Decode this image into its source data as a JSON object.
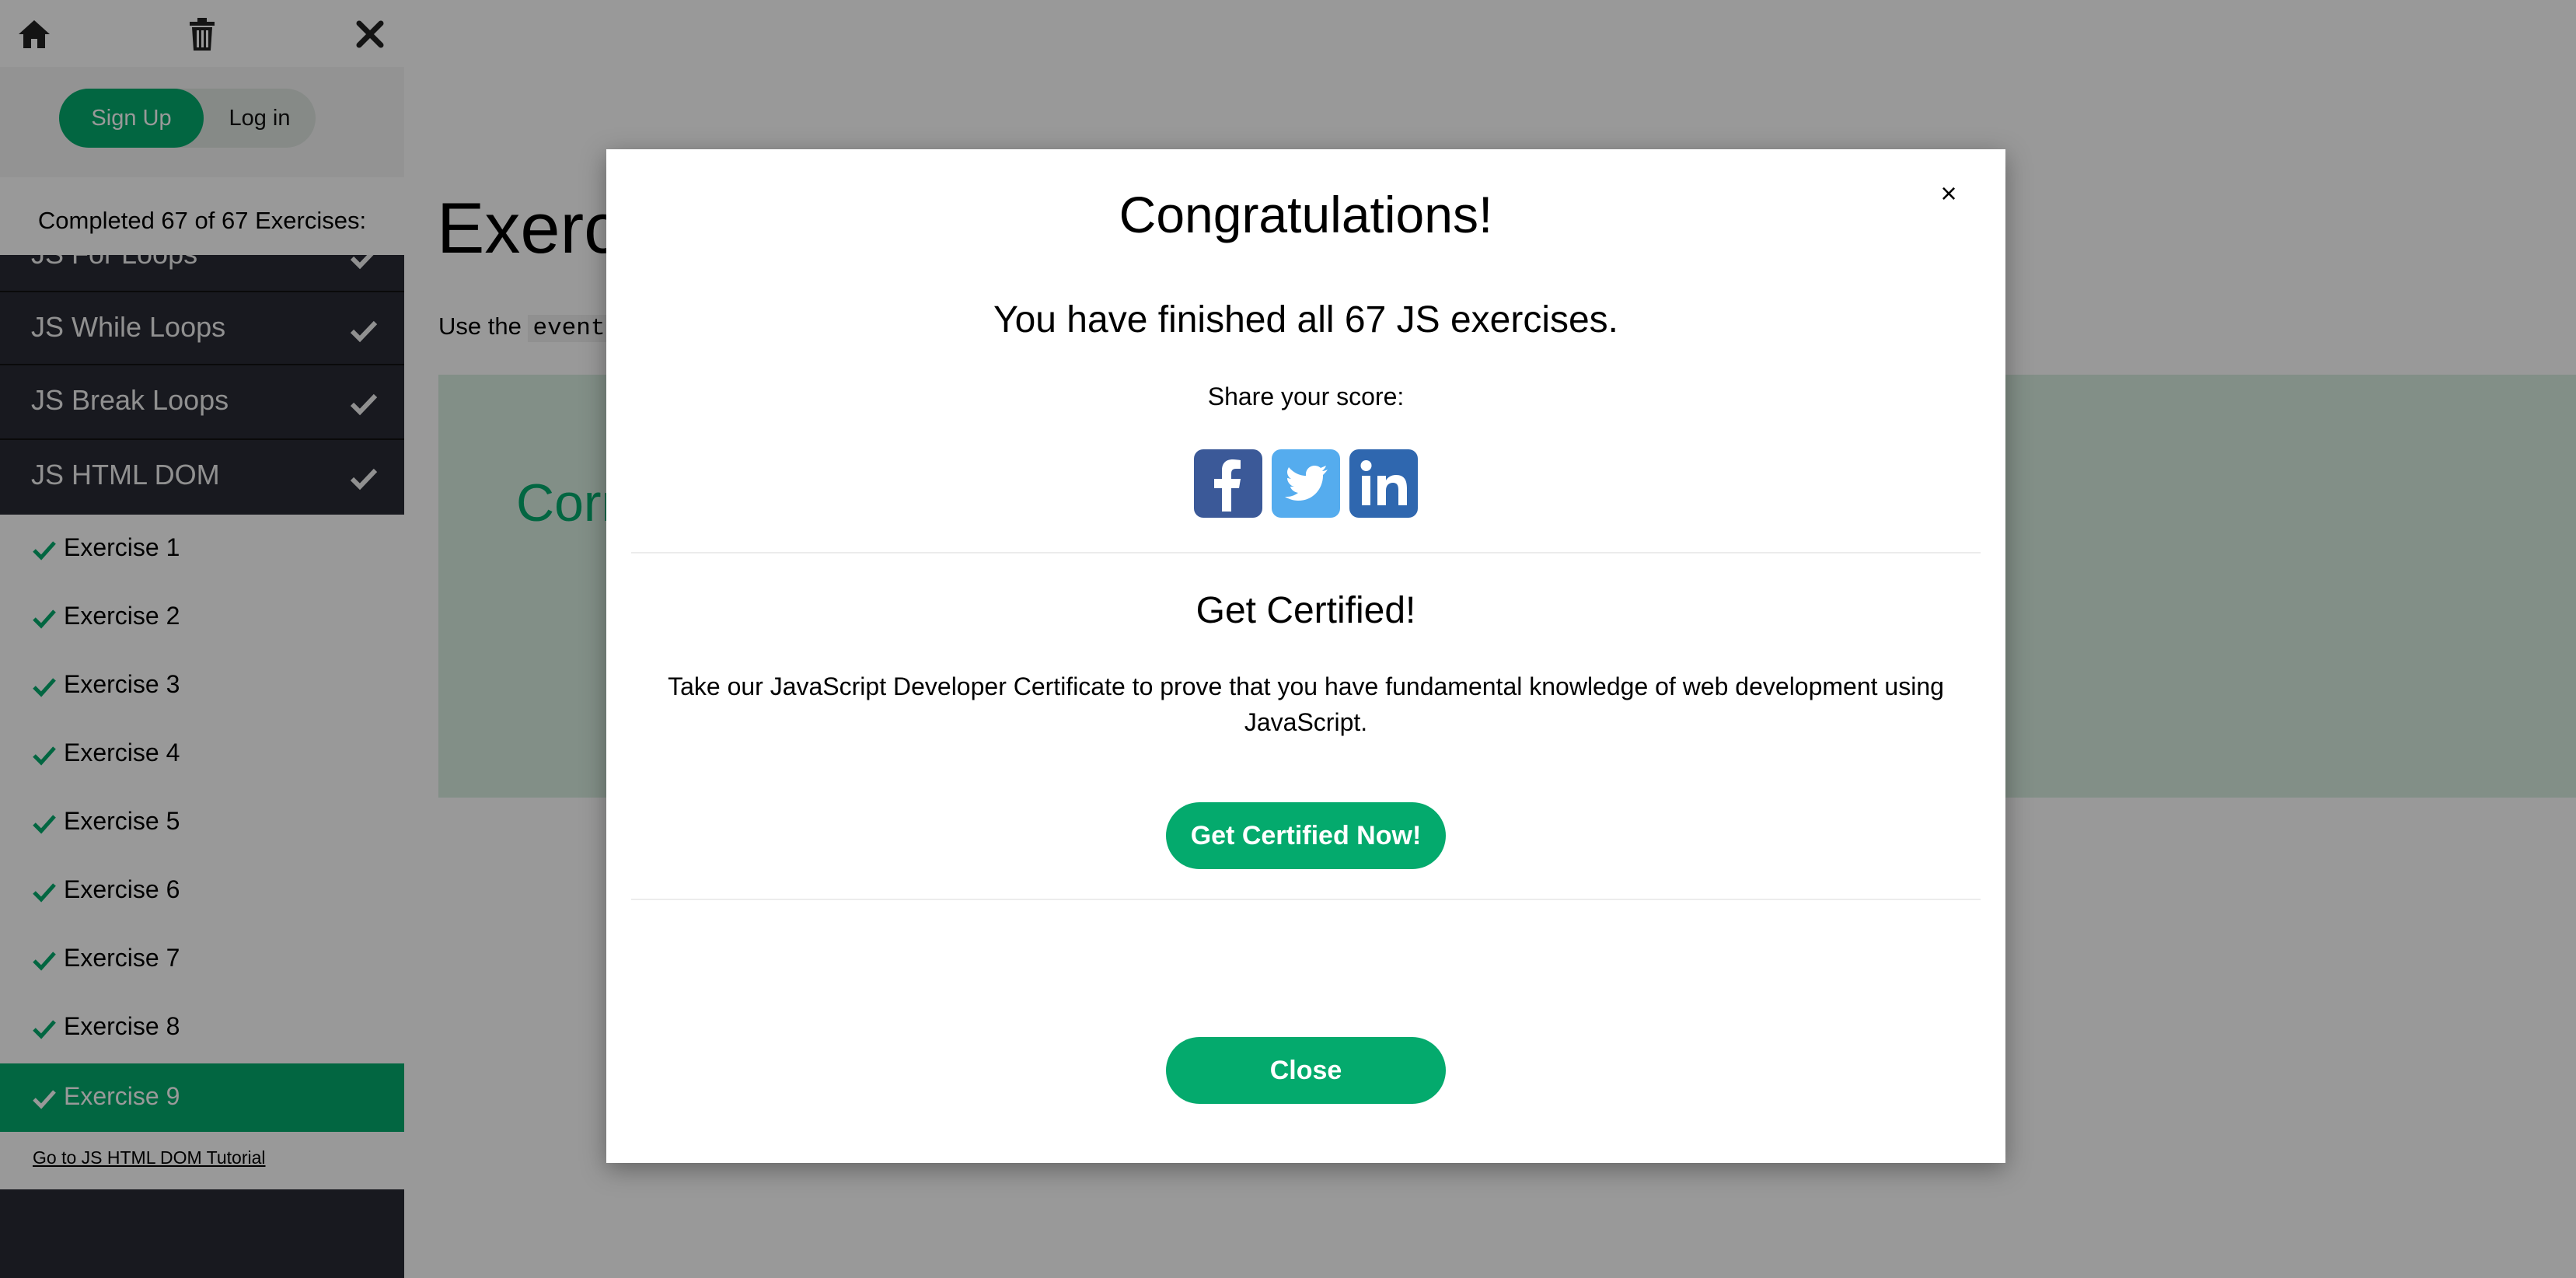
{
  "sidebar": {
    "top_icons": [
      "home-icon",
      "trash-icon",
      "close-icon"
    ],
    "signup_label": "Sign Up",
    "login_label": "Log in",
    "progress_text": "Completed 67 of 67 Exercises:",
    "sections": [
      {
        "label": "JS For Loops",
        "completed": true
      },
      {
        "label": "JS While Loops",
        "completed": true
      },
      {
        "label": "JS Break Loops",
        "completed": true
      },
      {
        "label": "JS HTML DOM",
        "completed": true
      }
    ],
    "exercises": [
      {
        "label": "Exercise 1",
        "completed": true
      },
      {
        "label": "Exercise 2",
        "completed": true
      },
      {
        "label": "Exercise 3",
        "completed": true
      },
      {
        "label": "Exercise 4",
        "completed": true
      },
      {
        "label": "Exercise 5",
        "completed": true
      },
      {
        "label": "Exercise 6",
        "completed": true
      },
      {
        "label": "Exercise 7",
        "completed": true
      },
      {
        "label": "Exercise 8",
        "completed": true
      },
      {
        "label": "Exercise 9",
        "completed": true,
        "active": true
      }
    ],
    "tutorial_link": "Go to JS HTML DOM Tutorial"
  },
  "main": {
    "title_partial": "Exerc",
    "instruction_prefix": "Use the",
    "instruction_code": "event",
    "result_partial": "Corr"
  },
  "modal": {
    "title": "Congratulations!",
    "finished_text": "You have finished all 67 JS exercises.",
    "share_label": "Share your score:",
    "social_icons": [
      "facebook-icon",
      "twitter-icon",
      "linkedin-icon"
    ],
    "cert_title": "Get Certified!",
    "cert_desc": "Take our JavaScript Developer Certificate to prove that you have fundamental knowledge of web development using JavaScript.",
    "cert_button": "Get Certified Now!",
    "close_button": "Close",
    "close_x": "×"
  },
  "colors": {
    "accent": "#04AA6D",
    "sidebar_dark": "#282A35",
    "facebook": "#3B5998",
    "twitter": "#55ACEE",
    "linkedin": "#2F67AF"
  }
}
